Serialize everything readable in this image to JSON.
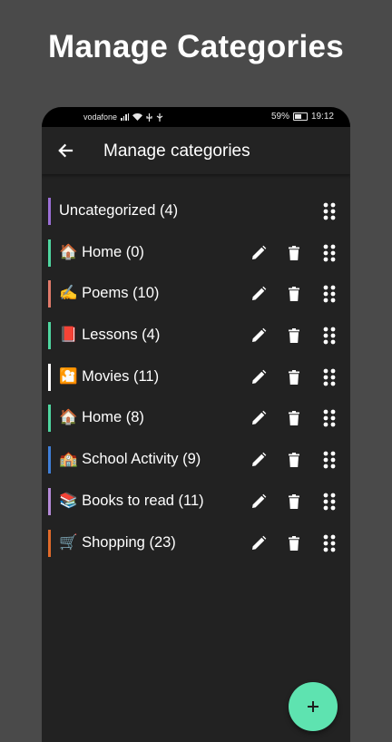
{
  "headline": "Manage Categories",
  "status_bar": {
    "carrier": "vodafone",
    "battery": "59%",
    "time": "19:12"
  },
  "app_bar": {
    "title": "Manage categories",
    "back_icon": "arrow-left-icon"
  },
  "categories": [
    {
      "label": "Uncategorized (4)",
      "color": "#9b6fd6",
      "editable": false
    },
    {
      "label": "🏠 Home (0)",
      "color": "#4fd6a0",
      "editable": true
    },
    {
      "label": "✍️ Poems (10)",
      "color": "#e07a6a",
      "editable": true
    },
    {
      "label": "📕 Lessons (4)",
      "color": "#4fd6a0",
      "editable": true
    },
    {
      "label": "🎦 Movies (11)",
      "color": "#ffffff",
      "editable": true
    },
    {
      "label": "🏠 Home (8)",
      "color": "#4fd6a0",
      "editable": true
    },
    {
      "label": "🏫 School Activity (9)",
      "color": "#3f7fd8",
      "editable": true
    },
    {
      "label": "📚 Books to read (11)",
      "color": "#b58ad8",
      "editable": true
    },
    {
      "label": "🛒 Shopping (23)",
      "color": "#e06a2a",
      "editable": true
    }
  ],
  "icons": {
    "edit": "pencil-icon",
    "delete": "trash-icon",
    "drag": "drag-handle-icon",
    "fab": "plus-icon"
  },
  "colors": {
    "fab": "#5ee3b0",
    "background": "#4a4a4a",
    "surface": "#222222"
  }
}
